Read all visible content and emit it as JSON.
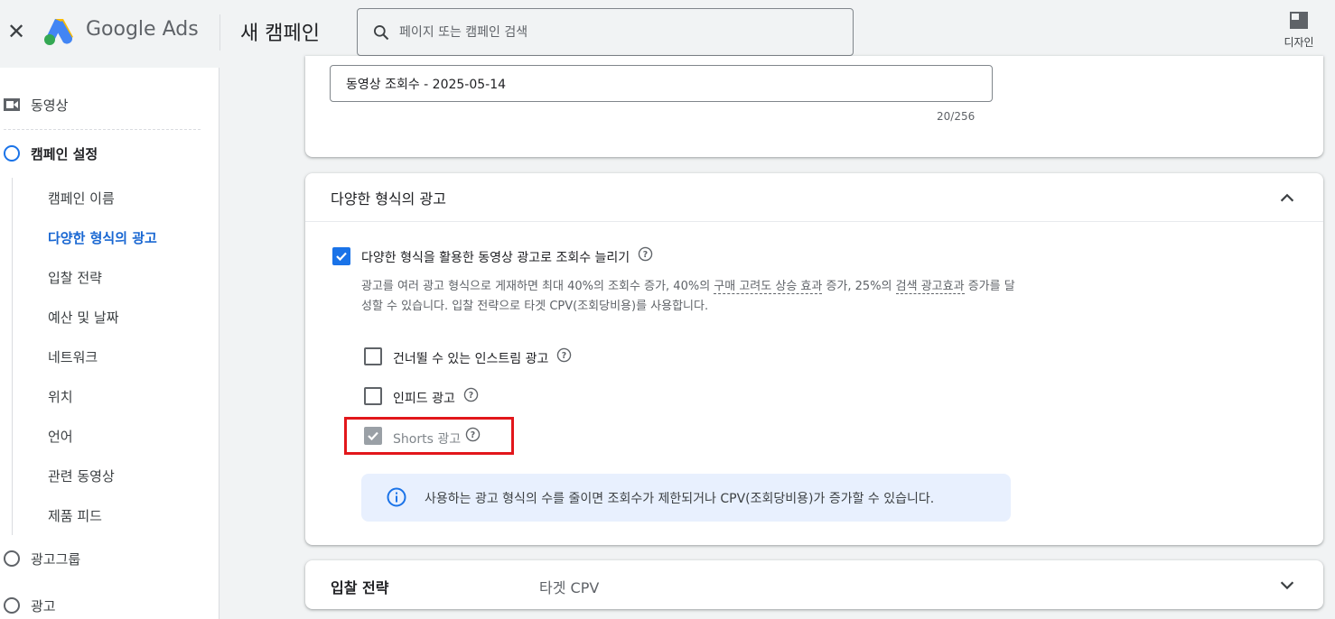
{
  "header": {
    "close_label": "✕",
    "logo_text": "Google Ads",
    "page_title": "새 캠페인",
    "search_placeholder": "페이지 또는 캠페인 검색",
    "design_label": "디자인"
  },
  "sidebar": {
    "video_label": "동영상",
    "campaign_settings_label": "캠페인 설정",
    "sub_items": [
      "캠페인 이름",
      "다양한 형식의 광고",
      "입찰 전략",
      "예산 및 날짜",
      "네트워크",
      "위치",
      "언어",
      "관련 동영상",
      "제품 피드"
    ],
    "active_sub_index": 1,
    "ad_group_label": "광고그룹",
    "ad_label": "광고"
  },
  "campaign_name": {
    "value": "동영상 조회수 - 2025-05-14",
    "char_count": "20/256"
  },
  "multi_format": {
    "title": "다양한 형식의 광고",
    "main_checkbox_label": "다양한 형식을 활용한 동영상 광고로 조회수 늘리기",
    "main_checked": true,
    "desc_part1": "광고를 여러 광고 형식으로 게재하면 최대 40%의 조회수 증가, 40%의 ",
    "desc_link1": "구매 고려도 상승 효과",
    "desc_part2": " 증가, 25%의 ",
    "desc_link2": "검색 광고효과",
    "desc_part3": " 증가를 달성할 수 있습니다. 입찰 전략으로 타겟 CPV(조회당비용)를 사용합니다.",
    "options": [
      {
        "label": "건너뛸 수 있는 인스트림 광고",
        "checked": false,
        "disabled": false
      },
      {
        "label": "인피드 광고",
        "checked": false,
        "disabled": false
      },
      {
        "label": "Shorts 광고",
        "checked": true,
        "disabled": true
      }
    ],
    "info_text": "사용하는 광고 형식의 수를 줄이면 조회수가 제한되거나 CPV(조회당비용)가 증가할 수 있습니다."
  },
  "bidding": {
    "title": "입찰 전략",
    "value": "타겟 CPV"
  },
  "colors": {
    "primary_blue": "#1a73e8",
    "highlight_red": "#e2171b",
    "info_bg": "#e8f0fe"
  }
}
